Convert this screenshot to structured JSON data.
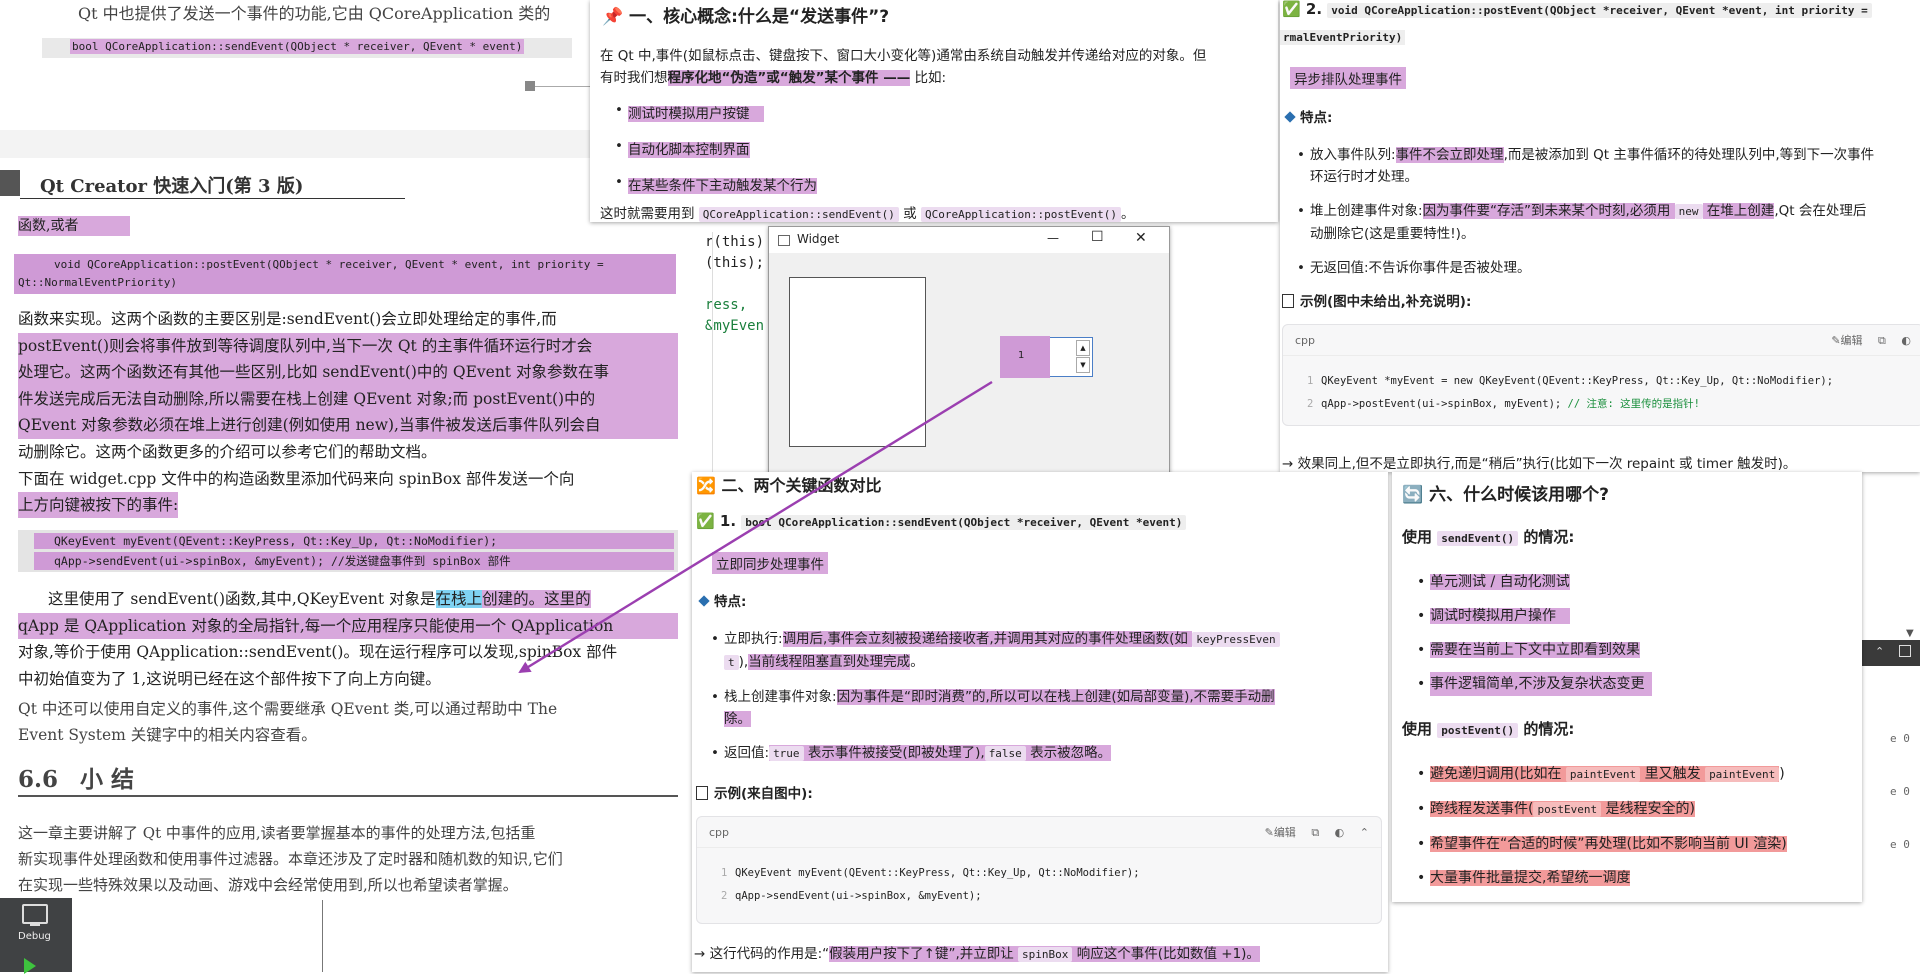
{
  "book": {
    "top_text": "Qt 中也提供了发送一个事件的功能,它由 QCoreApplication 类的",
    "top_code": "bool QCoreApplication::sendEvent(QObject * receiver, QEvent * event)",
    "header_title": "Qt Creator 快速入门(第 3 版)",
    "or_text": "函数,或者",
    "post_code_1": "void QCoreApplication::postEvent(QObject * receiver, QEvent * event, int priority =",
    "post_code_2": "Qt::NormalEventPriority)",
    "para1": [
      "函数来实现。这两个函数的主要区别是:sendEvent()会立即处理给定的事件,而",
      "postEvent()则会将事件放到等待调度队列中,当下一次 Qt 的主事件循环运行时才会",
      "处理它。这两个函数还有其他一些区别,比如 sendEvent()中的 QEvent 对象参数在事",
      "件发送完成后无法自动删除,所以需要在栈上创建 QEvent 对象;而 postEvent()中的",
      "QEvent 对象参数必须在堆上进行创建(例如使用 new),当事件被发送后事件队列会自",
      "动删除它。这两个函数更多的介绍可以参考它们的帮助文档。"
    ],
    "para2": [
      "    下面在 widget.cpp 文件中的构造函数里添加代码来向 spinBox 部件发送一个向",
      "上方向键被按下的事件:"
    ],
    "code_line1": "QKeyEvent myEvent(QEvent::KeyPress, Qt::Key_Up, Qt::NoModifier);",
    "code_line2": "qApp->sendEvent(ui->spinBox, &myEvent);           //发送键盘事件到 spinBox 部件",
    "para3_a": "这里使用了 sendEvent()函数,其中,QKeyEvent 对象是",
    "para3_b": "在栈上",
    "para3_c": "创建的。这里的",
    "para3_rest": [
      "qApp 是 QApplication 对象的全局指针,每一个应用程序只能使用一个 QApplication",
      "对象,等价于使用 QApplication::sendEvent()。现在运行程序可以发现,spinBox 部件",
      "中初始值变为了 1,这说明已经在这个部件按下了向上方向键。"
    ],
    "para4": [
      "    Qt 中还可以使用自定义的事件,这个需要继承 QEvent 类,可以通过帮助中 The",
      "Event System 关键字中的相关内容查看。"
    ],
    "section_num": "6.6",
    "section_title": "小  结",
    "para5": [
      "    这一章主要讲解了 Qt 中事件的应用,读者要掌握基本的事件的处理方法,包括重",
      "新实现事件处理函数和使用事件过滤器。本章还涉及了定时器和随机数的知识,它们",
      "在实现一些特殊效果以及动画、游戏中会经常使用到,所以也希望读者掌握。"
    ]
  },
  "editor_peek": {
    "lines": [
      "r(this)",
      "(this);",
      "",
      "ress,",
      "&myEven"
    ]
  },
  "debug": {
    "label": "Debug"
  },
  "right_peek": {
    "lines": [
      "e 0",
      "e 0",
      "e 0"
    ]
  },
  "panel_concept": {
    "emoji": "📌",
    "title": "一、核心概念:什么是“发送事件”?",
    "intro_1": "在 Qt 中,事件(如鼠标点击、键盘按下、窗口大小变化等)通常由系统自动触发并传递给对应的对象。但",
    "intro_2a": "有时我们想",
    "intro_2b": "程序化地“伪造”或“触发”某个事件 ——",
    "intro_2c": " 比如:",
    "bullets": [
      "测试时模拟用户按键",
      "自动化脚本控制界面",
      "在某些条件下主动触发某个行为"
    ],
    "need_a": "这时就需要用到 ",
    "need_code1": "QCoreApplication::sendEvent()",
    "need_or": " 或 ",
    "need_code2": "QCoreApplication::postEvent()",
    "need_end": "。"
  },
  "panel_post": {
    "check": "✅",
    "num": "2.",
    "sig_1": "void QCoreApplication::postEvent(QObject *receiver, QEvent *event, int priority =",
    "sig_2": "rmalEventPriority)",
    "subtitle": "异步排队处理事件",
    "feat_title": "特点:",
    "b1_a": "放入事件队列:",
    "b1_b": "事件不会立即处理",
    "b1_c": ",而是被添加到 Qt 主事件循环的待处理队列中,等到下一次事件",
    "b1_d": "环运行时才处理。",
    "b2_a": "堆上创建事件对象:",
    "b2_b": "因为事件要“存活”到未来某个时刻,必须用 ",
    "b2_code": "new",
    "b2_c": " 在堆上创建",
    "b2_d": ",Qt 会在处理后",
    "b2_e": "动删除它(这是重要特性!)。",
    "b3": "无返回值:不告诉你事件是否被处理。",
    "example_title": "示例(图中未给出,补充说明):",
    "code_lang": "cpp",
    "edit_label": "编辑",
    "code1": "QKeyEvent *myEvent = new QKeyEvent(QEvent::KeyPress, Qt::Key_Up, Qt::NoModifier);",
    "code2a": "qApp->postEvent(ui->spinBox, myEvent);  ",
    "code2b": "// 注意: 这里传的是指针!",
    "effect": "→ 效果同上,但不是立即执行,而是“稍后”执行(比如下一次 repaint 或 timer 触发时)。"
  },
  "widget_window": {
    "title": "Widget",
    "spin_value": "1",
    "min_glyph": "—",
    "max_glyph": "☐",
    "close_glyph": "✕"
  },
  "panel_compare": {
    "emoji": "🔀",
    "title": "二、两个关键函数对比",
    "check": "✅",
    "num": "1.",
    "sig": "bool QCoreApplication::sendEvent(QObject *receiver, QEvent *event)",
    "subtitle": "立即同步处理事件",
    "feat_title": "特点:",
    "b1_a": "立即执行:",
    "b1_b": "调用后,事件会立刻被投递给接收者,并调用其对应的事件处理函数(如 ",
    "b1_code": "keyPressEven",
    "b1_c": "t",
    "b1_d": "),",
    "b1_e": "当前线程阻塞直到处理完成",
    "b1_f": "。",
    "b2_a": "栈上创建事件对象:",
    "b2_b": "因为事件是“即时消费”的,所以可以在栈上创建(如局部变量),不需要手动删",
    "b2_c": "除。",
    "b3_a": "返回值:",
    "b3_code1": "true",
    "b3_b": " 表示事件被接受(即被处理了),",
    "b3_code2": "false",
    "b3_c": " 表示被忽略。",
    "example_title": "示例(来自图中):",
    "code_lang": "cpp",
    "edit_label": "编辑",
    "code1": "QKeyEvent myEvent(QEvent::KeyPress, Qt::Key_Up, Qt::NoModifier);",
    "code2": "qApp->sendEvent(ui->spinBox, &myEvent);",
    "effect_a": "→ 这行代码的作用是:“",
    "effect_b": "假装用户按下了↑键”,并立即让 ",
    "effect_code": "spinBox",
    "effect_c": " 响应这个事件(比如数值 +1)。"
  },
  "panel_when": {
    "emoji": "🔄",
    "title": "六、什么时候该用哪个?",
    "use": "使用 ",
    "send_code": "sendEvent()",
    "case": " 的情况:",
    "send_items": [
      "单元测试 / 自动化测试",
      "调试时模拟用户操作",
      "需要在当前上下文中立即看到效果",
      "事件逻辑简单,不涉及复杂状态变更"
    ],
    "post_code": "postEvent()",
    "post_i1_a": "避免递归调用(比如在 ",
    "post_i1_code1": "paintEvent",
    "post_i1_b": " 里又触发 ",
    "post_i1_code2": "paintEvent",
    "post_i1_c": ")",
    "post_i2_a": "跨线程发送事件(",
    "post_i2_code": "postEvent",
    "post_i2_b": " 是线程安全的)",
    "post_i3": "希望事件在“合适的时候”再处理(比如不影响当前 UI 渲染)",
    "post_i4": "大量事件批量提交,希望统一调度"
  },
  "colors": {
    "highlight": "#d8a8dc",
    "highlight_red": "#f29a9a",
    "highlight_blue": "#7fd3f3",
    "arrow": "#9b3fb0"
  }
}
